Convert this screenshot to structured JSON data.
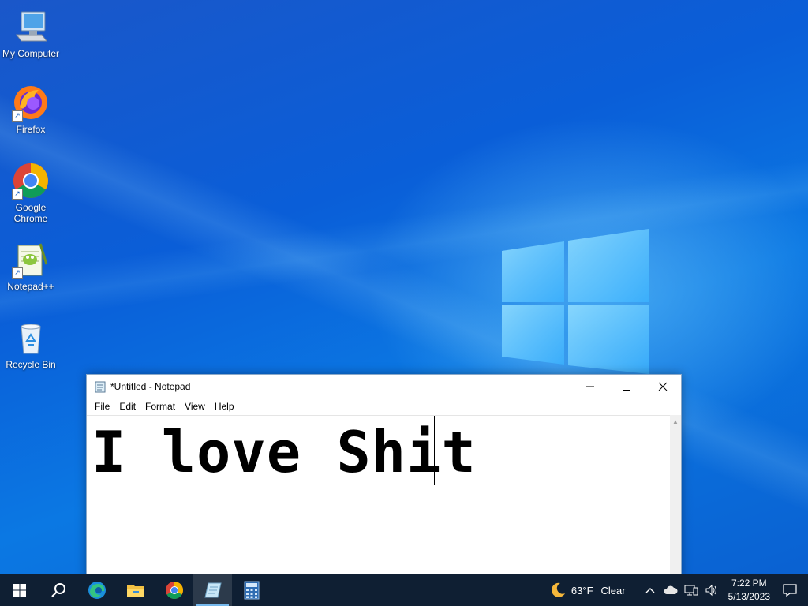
{
  "desktop": {
    "icons": [
      {
        "label": "My Computer",
        "icon": "computer-icon",
        "shortcut": false
      },
      {
        "label": "Firefox",
        "icon": "firefox-icon",
        "shortcut": true
      },
      {
        "label": "Google Chrome",
        "icon": "chrome-icon",
        "shortcut": true
      },
      {
        "label": "Notepad++",
        "icon": "notepadpp-icon",
        "shortcut": true
      },
      {
        "label": "Recycle Bin",
        "icon": "recycle-bin-icon",
        "shortcut": false
      }
    ]
  },
  "notepad": {
    "title": "*Untitled - Notepad",
    "menu": [
      "File",
      "Edit",
      "Format",
      "View",
      "Help"
    ],
    "content": "I love Shit",
    "controls": {
      "minimize": "minimize-icon",
      "maximize": "maximize-icon",
      "close": "close-icon"
    }
  },
  "taskbar": {
    "items": [
      {
        "icon": "start-icon",
        "active": false
      },
      {
        "icon": "search-icon",
        "active": false
      },
      {
        "icon": "edge-icon",
        "active": false
      },
      {
        "icon": "file-explorer-icon",
        "active": false
      },
      {
        "icon": "chrome-icon",
        "active": false
      },
      {
        "icon": "notepad-icon",
        "active": true
      },
      {
        "icon": "calculator-icon",
        "active": false
      }
    ],
    "weather": {
      "temp": "63°F",
      "condition": "Clear",
      "icon": "moon-icon"
    },
    "time": "7:22 PM",
    "date": "5/13/2023"
  },
  "colors": {
    "taskbar_bg": "#0f1f33",
    "desktop_blue": "#0a5ed8",
    "active_indicator": "#76b9ed"
  }
}
